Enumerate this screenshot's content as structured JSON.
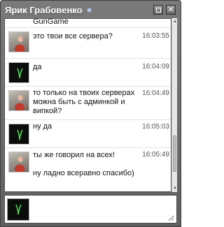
{
  "window": {
    "title": "Ярик Грабовенко",
    "status": "online",
    "buttons": [
      "restore-icon",
      "close-icon"
    ]
  },
  "conversation": {
    "partial_top_text": "GunGame",
    "messages": [
      {
        "avatar": "photo",
        "text": "это твои все сервера?",
        "time": "16:03:55"
      },
      {
        "avatar": "dark",
        "text": "да",
        "time": "16:04:09"
      },
      {
        "avatar": "photo",
        "text": "то только на твоих серверах можна быть с админкой и випкой?",
        "time": "16:04:49"
      },
      {
        "avatar": "dark",
        "text": "ну да",
        "time": "16:05:03"
      },
      {
        "avatar": "photo",
        "text": "ты же говорил на всех!\n\nну ладно всеравно спасибо)",
        "time": "16:05:49"
      }
    ]
  },
  "composer": {
    "value": "",
    "placeholder": ""
  }
}
